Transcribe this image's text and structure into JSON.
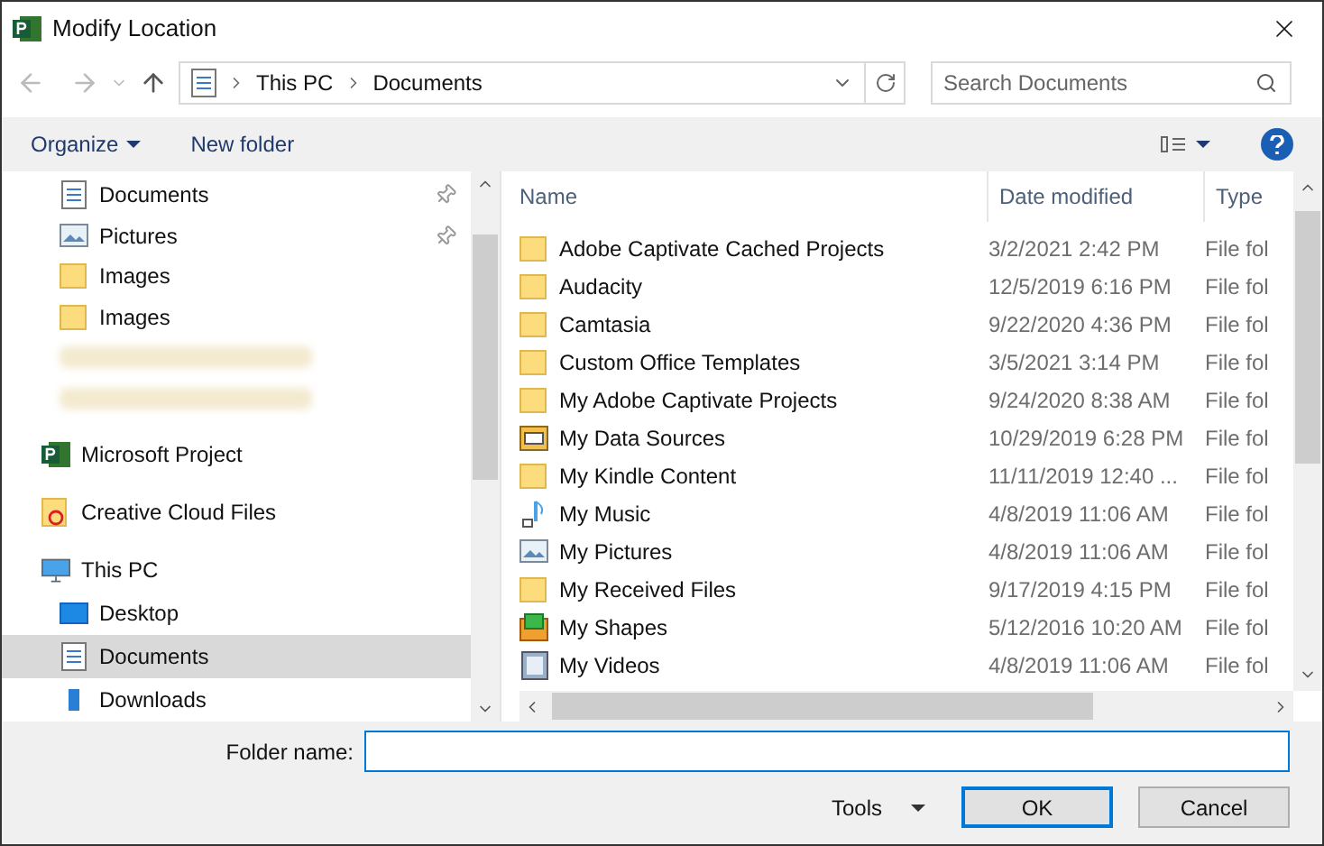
{
  "window": {
    "title": "Modify Location"
  },
  "address": {
    "path": [
      "This PC",
      "Documents"
    ]
  },
  "search": {
    "placeholder": "Search Documents"
  },
  "toolbar": {
    "organize": "Organize",
    "new_folder": "New folder"
  },
  "sidebar": {
    "quick_access": [
      {
        "label": "Documents",
        "kind": "document",
        "pinned": true,
        "selected": false
      },
      {
        "label": "Pictures",
        "kind": "picture",
        "pinned": true,
        "selected": false
      },
      {
        "label": "Images",
        "kind": "folder",
        "pinned": false,
        "selected": false
      },
      {
        "label": "Images",
        "kind": "folder",
        "pinned": false,
        "selected": false
      },
      {
        "kind": "blurred"
      },
      {
        "kind": "blurred"
      }
    ],
    "items": [
      {
        "label": "Microsoft Project",
        "kind": "project",
        "selected": false
      },
      {
        "label": "Creative Cloud Files",
        "kind": "cloud",
        "selected": false
      },
      {
        "label": "This PC",
        "kind": "pc",
        "selected": false,
        "children": [
          {
            "label": "Desktop",
            "kind": "desktop",
            "selected": false
          },
          {
            "label": "Documents",
            "kind": "document",
            "selected": true
          },
          {
            "label": "Downloads",
            "kind": "download",
            "selected": false
          }
        ]
      }
    ]
  },
  "table": {
    "columns": [
      "Name",
      "Date modified",
      "Type"
    ],
    "rows": [
      {
        "name": "Adobe Captivate Cached Projects",
        "date": "3/2/2021 2:42 PM",
        "type": "File fol",
        "kind": "folder"
      },
      {
        "name": "Audacity",
        "date": "12/5/2019 6:16 PM",
        "type": "File fol",
        "kind": "folder"
      },
      {
        "name": "Camtasia",
        "date": "9/22/2020 4:36 PM",
        "type": "File fol",
        "kind": "folder"
      },
      {
        "name": "Custom Office Templates",
        "date": "3/5/2021 3:14 PM",
        "type": "File fol",
        "kind": "folder"
      },
      {
        "name": "My Adobe Captivate Projects",
        "date": "9/24/2020 8:38 AM",
        "type": "File fol",
        "kind": "folder"
      },
      {
        "name": "My Data Sources",
        "date": "10/29/2019 6:28 PM",
        "type": "File fol",
        "kind": "data"
      },
      {
        "name": "My Kindle Content",
        "date": "11/11/2019 12:40 ...",
        "type": "File fol",
        "kind": "folder"
      },
      {
        "name": "My Music",
        "date": "4/8/2019 11:06 AM",
        "type": "File fol",
        "kind": "music"
      },
      {
        "name": "My Pictures",
        "date": "4/8/2019 11:06 AM",
        "type": "File fol",
        "kind": "picture"
      },
      {
        "name": "My Received Files",
        "date": "9/17/2019 4:15 PM",
        "type": "File fol",
        "kind": "folder"
      },
      {
        "name": "My Shapes",
        "date": "5/12/2016 10:20 AM",
        "type": "File fol",
        "kind": "shapes"
      },
      {
        "name": "My Videos",
        "date": "4/8/2019 11:06 AM",
        "type": "File fol",
        "kind": "video"
      }
    ]
  },
  "footer": {
    "folder_name_label": "Folder name:",
    "tools": "Tools",
    "ok": "OK",
    "cancel": "Cancel"
  }
}
